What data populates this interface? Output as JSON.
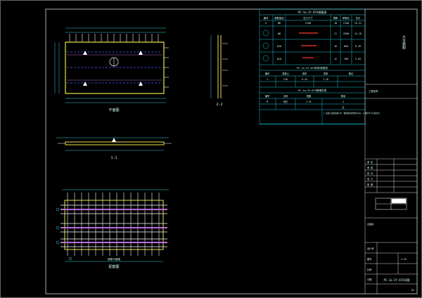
{
  "colors": {
    "background": "#000000",
    "frame": "#d8d8d8",
    "table_lines": "#19c6d6",
    "slab": "#e8e54a",
    "rebar": "#ffffff",
    "cyan_dim": "#2fd3e0",
    "red_mark": "#ff3b30",
    "magenta": "#b86ad8",
    "blue_dash": "#4a5cff",
    "green_dim": "#3cf03c"
  },
  "drawing": {
    "plan_label": "平面图",
    "section_1_label": "1-1",
    "section_2_label": "2-2",
    "rebar_label": "配筋图",
    "rebar_sub": "钢筋平面图"
  },
  "schedule_table": {
    "title": "PC-1a-2Y-874钢筋表",
    "header": [
      "编号",
      "钢筋直径",
      "加工尺寸",
      "根数",
      "单根长",
      "总长",
      "重量"
    ],
    "rows": [
      [
        "①",
        "Φ8",
        "2140",
        "18",
        "2140",
        "38.52",
        "15.21"
      ],
      [
        "②",
        "Φ8",
        "3260",
        "11",
        "3260",
        "35.86",
        "14.16"
      ],
      [
        "③",
        "Φ10",
        "850",
        "16",
        "850",
        "13.60",
        "8.39"
      ],
      [
        "④",
        "Φ10",
        "760",
        "12",
        "760",
        "9.12",
        "5.63"
      ]
    ],
    "sub1_title": "PC-1a-2Y-874构件参数表",
    "sub1_header": [
      "编号",
      "混凝土",
      "体积",
      "重量",
      "备注"
    ],
    "sub1_row": [
      "1",
      "C30",
      "0.44",
      "1.10",
      ""
    ],
    "sub2_title": "PC-1a-2Y-874预埋件表",
    "sub2_header": [
      "编号",
      "名称",
      "规格",
      "数量"
    ],
    "sub2_row": [
      "M",
      "吊钉",
      "2.5t",
      "4"
    ],
    "note_label": "注",
    "note_text": "1.混凝土强度等级C30，钢筋保护层厚度15mm。2.图中尺寸以毫米计。"
  },
  "title_block": {
    "project_label": "工程名称",
    "vertical_title": "大方案配",
    "rows": [
      "审 定",
      "审 核",
      "校 对",
      "设 计",
      "制 图"
    ],
    "design_no_label": "设计号",
    "drawing_no_label": "图号",
    "scale_label": "比例",
    "date_label": "日期",
    "sheet_title": "PC-1a-2Y-874详图",
    "scale_value": "1:20",
    "page_no": "01",
    "stamp_label": "出图章"
  }
}
